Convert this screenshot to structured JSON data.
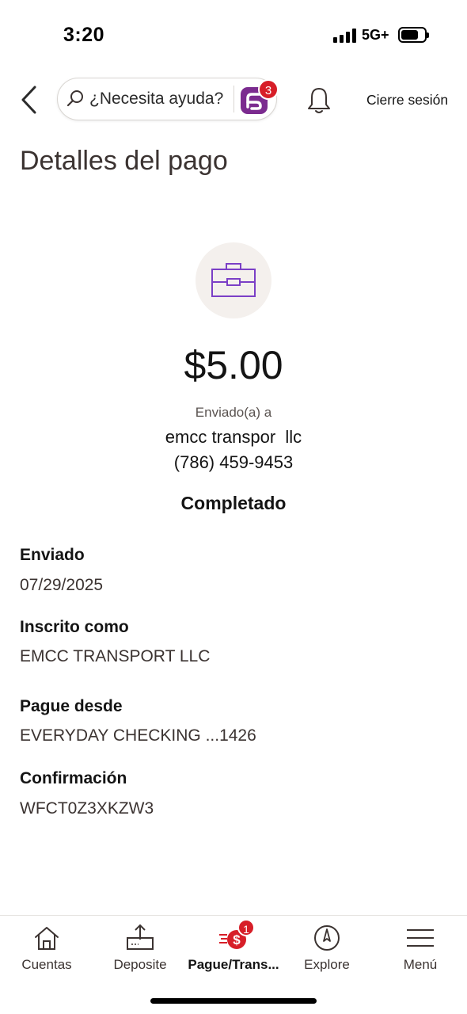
{
  "status_bar": {
    "time": "3:20",
    "network": "5G+"
  },
  "header": {
    "search_placeholder": "¿Necesita ayuda?",
    "assistant_badge": "3",
    "logout_label": "Cierre sesión"
  },
  "page": {
    "title": "Detalles del pago"
  },
  "payment": {
    "amount": "$5.00",
    "sent_to_label": "Enviado(a) a",
    "payee_name": "emcc transpor  llc",
    "payee_phone": "(786) 459-9453",
    "status": "Completado"
  },
  "details": [
    {
      "label": "Enviado",
      "value": "07/29/2025"
    },
    {
      "label": "Inscrito como",
      "value": "EMCC TRANSPORT LLC"
    },
    {
      "label": "Pague desde",
      "value": "EVERYDAY CHECKING ...1426"
    },
    {
      "label": "Confirmación",
      "value": "WFCT0Z3XKZW3"
    }
  ],
  "bottom_nav": {
    "items": [
      {
        "label": "Cuentas",
        "icon": "house-icon"
      },
      {
        "label": "Deposite",
        "icon": "deposit-check-icon"
      },
      {
        "label": "Pague/Trans...",
        "icon": "pay-transfer-icon",
        "badge": "1",
        "active": true
      },
      {
        "label": "Explore",
        "icon": "compass-icon"
      },
      {
        "label": "Menú",
        "icon": "hamburger-menu-icon"
      }
    ]
  },
  "colors": {
    "brand_red": "#d71e28",
    "brand_purple": "#7b2b8f",
    "payee_icon": "#7b3fc6"
  }
}
